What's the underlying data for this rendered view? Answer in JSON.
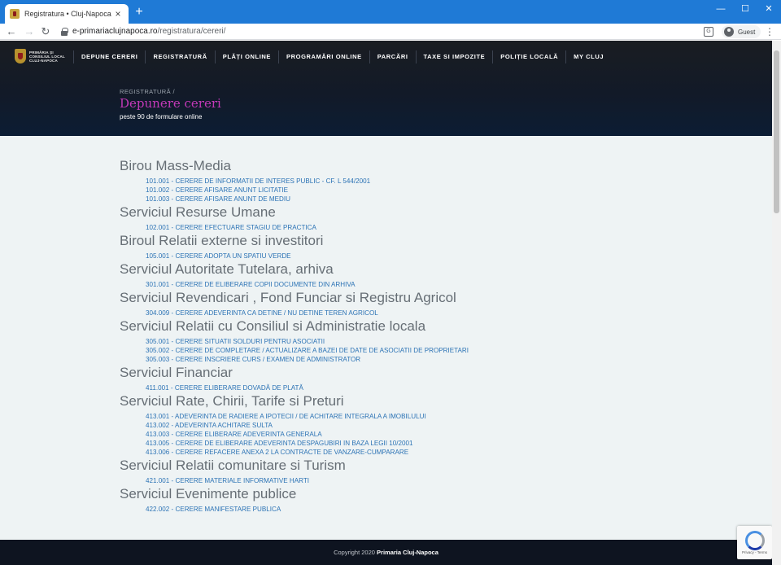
{
  "browser": {
    "tab_title": "Registratura • Cluj-Napoca",
    "tab_close": "×",
    "new_tab": "+",
    "window_controls": {
      "minimize": "—",
      "maximize": "☐",
      "close": "✕"
    },
    "url_host": "e-primariaclujnapoca.ro",
    "url_path": "/registratura/cereri/",
    "profile_label": "Guest",
    "icons": [
      "back-icon",
      "forward-icon",
      "reload-icon",
      "lock-icon",
      "translate-icon",
      "avatar-icon",
      "menu-icon"
    ]
  },
  "header": {
    "logo_lines": [
      "PRIMĂRIA ȘI",
      "CONSILIUL LOCAL",
      "CLUJ-NAPOCA"
    ],
    "nav": [
      "DEPUNE CERERI",
      "REGISTRATURĂ",
      "PLĂȚI ONLINE",
      "PROGRAMĂRI ONLINE",
      "PARCĂRI",
      "TAXE SI IMPOZITE",
      "POLIȚIE LOCALĂ",
      "MY CLUJ"
    ],
    "breadcrumb": "REGISTRATURĂ /",
    "title": "Depunere cereri",
    "subtitle": "peste 90 de formulare online"
  },
  "sections": [
    {
      "title": "Birou Mass-Media",
      "links": [
        "101.001 - CERERE DE INFORMATII DE INTERES PUBLIC - CF. L 544/2001",
        "101.002 - CERERE AFISARE ANUNT LICITATIE",
        "101.003 - CERERE AFISARE ANUNT DE MEDIU"
      ]
    },
    {
      "title": "Serviciul Resurse Umane",
      "links": [
        "102.001 - CERERE EFECTUARE STAGIU DE PRACTICA"
      ]
    },
    {
      "title": "Biroul Relatii externe si investitori",
      "links": [
        "105.001 - CERERE ADOPTA UN SPATIU VERDE"
      ]
    },
    {
      "title": "Serviciul Autoritate Tutelara, arhiva",
      "links": [
        "301.001 - CERERE DE ELIBERARE COPII DOCUMENTE DIN ARHIVA"
      ]
    },
    {
      "title": "Serviciul Revendicari , Fond Funciar si Registru Agricol",
      "links": [
        "304.009 - CERERE ADEVERINTA CA DETINE / NU DETINE TEREN AGRICOL"
      ]
    },
    {
      "title": "Serviciul Relatii cu Consiliul si Administratie locala",
      "links": [
        "305.001 - CERERE SITUATII SOLDURI PENTRU ASOCIATII",
        "305.002 - CERERE DE COMPLETARE / ACTUALIZARE A BAZEI DE DATE DE ASOCIATII DE PROPRIETARI",
        "305.003 - CERERE INSCRIERE CURS / EXAMEN DE ADMINISTRATOR"
      ]
    },
    {
      "title": "Serviciul Financiar",
      "links": [
        "411.001 - CERERE ELIBERARE DOVADĂ DE PLATĂ"
      ]
    },
    {
      "title": "Serviciul Rate, Chirii, Tarife si Preturi",
      "links": [
        "413.001 - ADEVERINTA DE RADIERE A IPOTECII / DE ACHITARE INTEGRALA A IMOBILULUI",
        "413.002 - ADEVERINTA ACHITARE SULTA",
        "413.003 - CERERE ELIBERARE ADEVERINTA GENERALA",
        "413.005 - CERERE DE ELIBERARE ADEVERINTA DESPAGUBIRI IN BAZA LEGII 10/2001",
        "413.006 - CERERE REFACERE ANEXA 2 LA CONTRACTE DE VANZARE-CUMPARARE"
      ]
    },
    {
      "title": "Serviciul Relatii comunitare si Turism",
      "links": [
        "421.001 - CERERE MATERIALE INFORMATIVE HARTI"
      ]
    },
    {
      "title": "Serviciul Evenimente publice",
      "links": [
        "422.002 - CERERE MANIFESTARE PUBLICA"
      ]
    }
  ],
  "footer": {
    "copyright": "Copyright 2020",
    "owner": "Primaria Cluj-Napoca"
  },
  "recaptcha": {
    "text": "Privacy - Terms"
  },
  "colors": {
    "chrome_blue": "#1f7ad6",
    "hero_dark": "#121a28",
    "title_magenta": "#c339b8",
    "link_blue": "#2c73b5",
    "section_gray": "#666e75",
    "page_bg": "#eef3f4"
  }
}
